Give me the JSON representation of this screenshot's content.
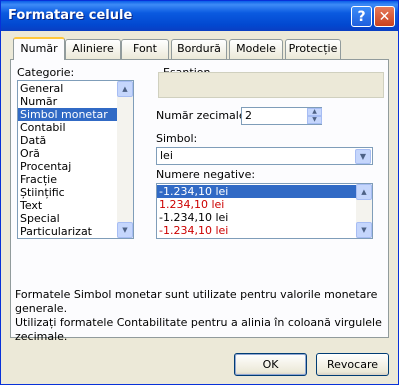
{
  "window": {
    "title": "Formatare celule"
  },
  "titlebar": {
    "help_glyph": "?",
    "close_glyph": "✕"
  },
  "tabs": [
    {
      "label": "Număr",
      "active": true
    },
    {
      "label": "Aliniere"
    },
    {
      "label": "Font"
    },
    {
      "label": "Bordură"
    },
    {
      "label": "Modele"
    },
    {
      "label": "Protecție"
    }
  ],
  "category": {
    "label": "Categorie:",
    "items": [
      "General",
      "Număr",
      "Simbol monetar",
      "Contabil",
      "Dată",
      "Oră",
      "Procentaj",
      "Fracție",
      "Științific",
      "Text",
      "Special",
      "Particularizat"
    ],
    "selected": "Simbol monetar"
  },
  "sample": {
    "label": "Eșantion",
    "value": ""
  },
  "decimals": {
    "label": "Număr zecimale:",
    "value": "2"
  },
  "symbol": {
    "label": "Simbol:",
    "value": "lei"
  },
  "negative": {
    "label": "Numere negative:",
    "items": [
      {
        "text": "-1.234,10 lei",
        "color": "#000000",
        "selected": true
      },
      {
        "text": "1.234,10 lei",
        "color": "#cc0000"
      },
      {
        "text": "-1.234,10 lei",
        "color": "#000000"
      },
      {
        "text": "-1.234,10 lei",
        "color": "#cc0000"
      }
    ]
  },
  "description": {
    "line1": "Formatele Simbol monetar sunt utilizate pentru valorile monetare generale.",
    "line2": "Utilizați formatele Contabilitate pentru a alinia în coloană virgulele zecimale."
  },
  "buttons": {
    "ok": "OK",
    "cancel": "Revocare"
  },
  "colors": {
    "title_bar": "#0a5ae0",
    "selection": "#316ac5",
    "negative_red": "#cc0000"
  },
  "icons": {
    "help": "help-icon",
    "close": "close-icon",
    "scroll_up": "scroll-up-icon",
    "scroll_down": "scroll-down-icon",
    "dropdown": "chevron-down-icon"
  }
}
